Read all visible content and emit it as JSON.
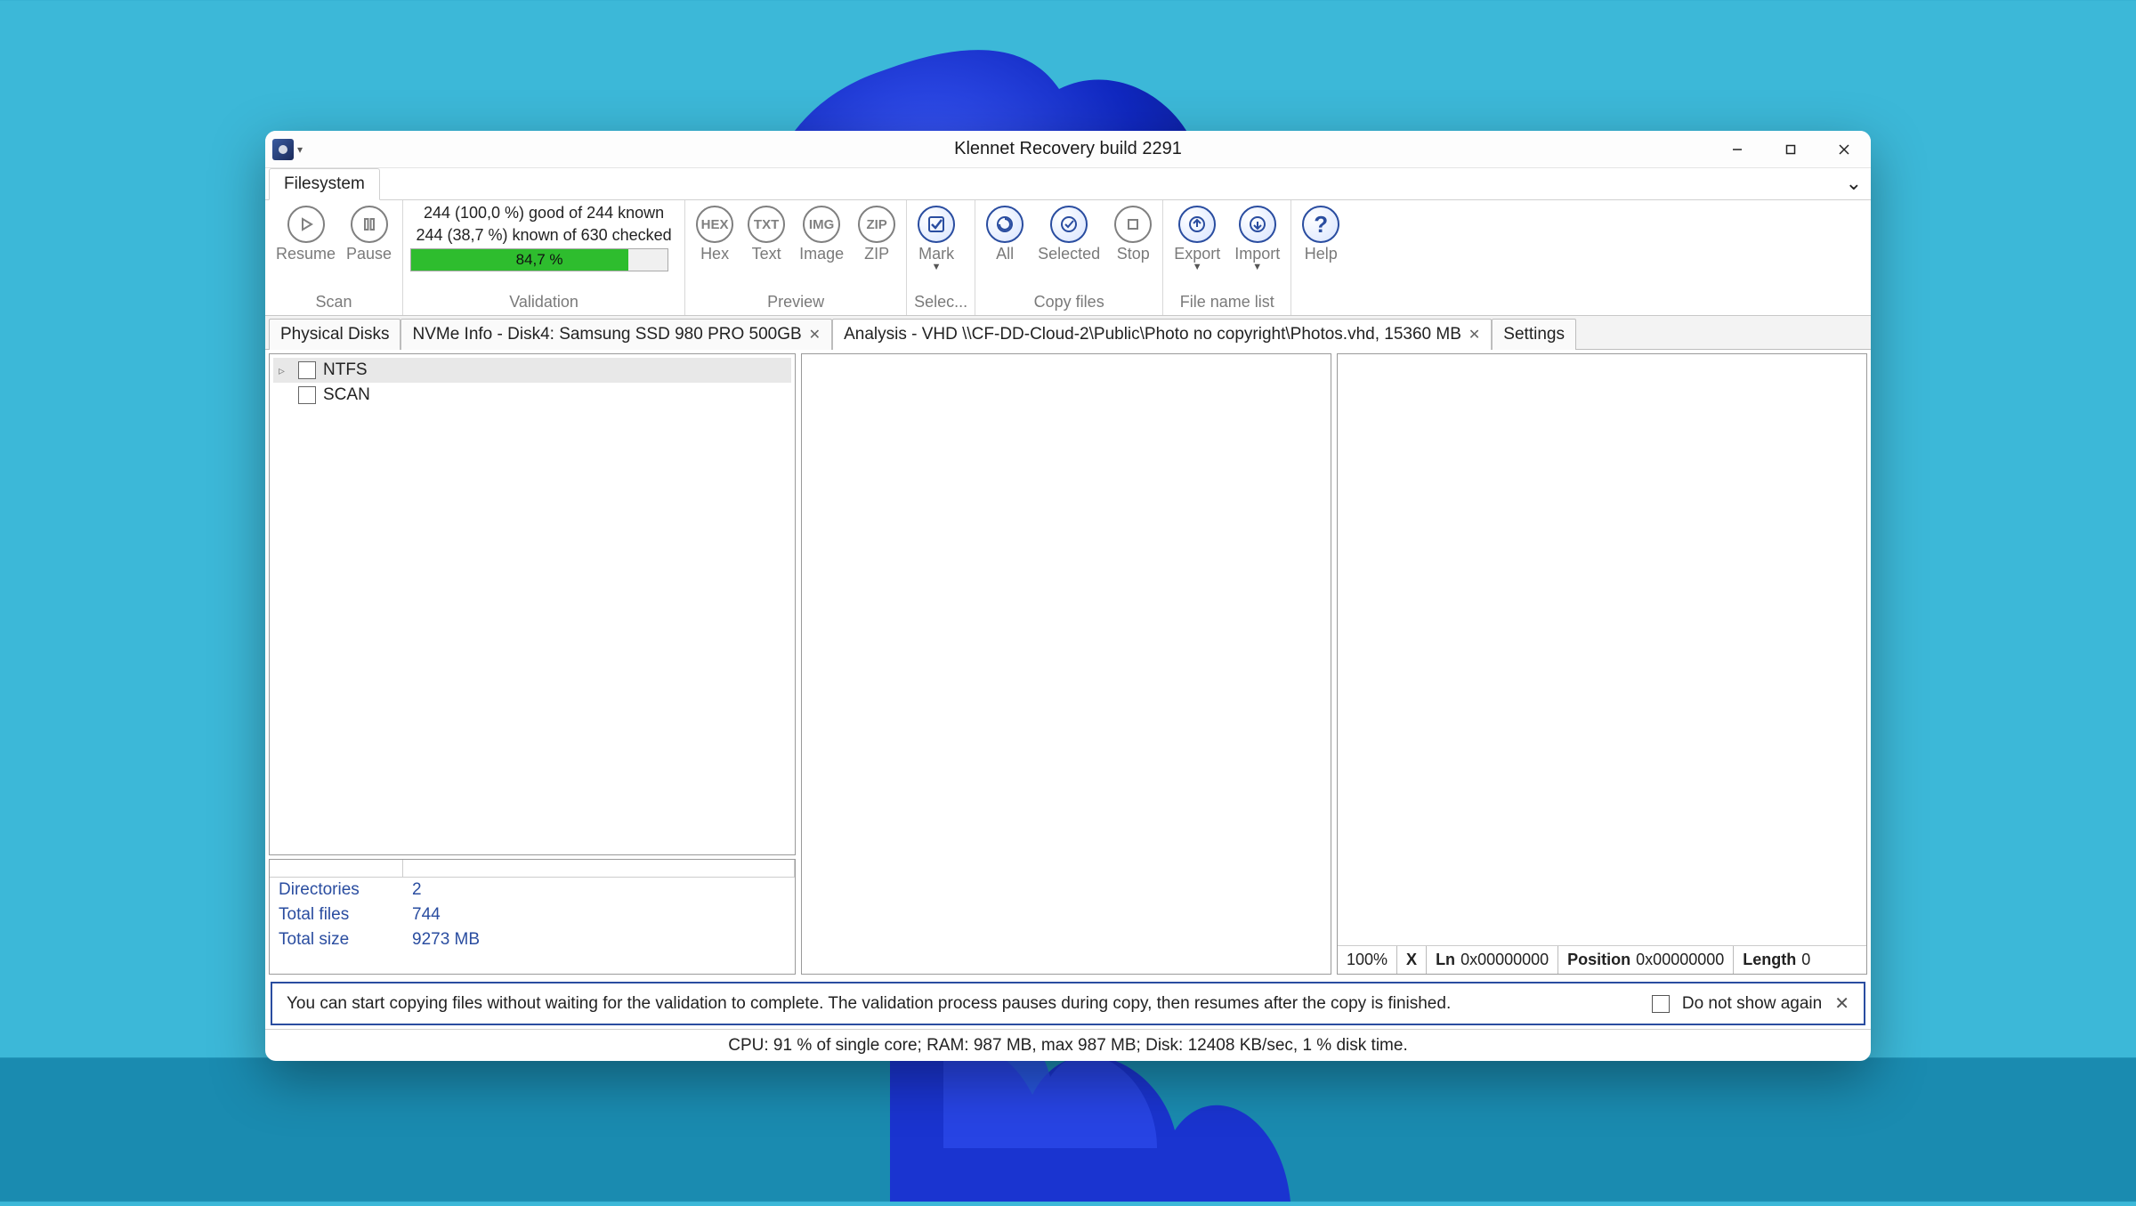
{
  "title": "Klennet Recovery build 2291",
  "ribbon_tab": "Filesystem",
  "scan": {
    "resume": "Resume",
    "pause": "Pause",
    "group": "Scan"
  },
  "validation": {
    "line1": "244 (100,0 %) good of 244 known",
    "line2": "244 (38,7 %) known of 630 checked",
    "percent": "84,7 %",
    "percent_num": 84.7,
    "group": "Validation"
  },
  "preview": {
    "hex": "Hex",
    "txt": "Text",
    "img": "Image",
    "zip": "ZIP",
    "group": "Preview"
  },
  "select": {
    "mark": "Mark",
    "group": "Selec..."
  },
  "copy": {
    "all": "All",
    "selected": "Selected",
    "stop": "Stop",
    "group": "Copy files"
  },
  "fnl": {
    "export": "Export",
    "import": "Import",
    "group": "File name list"
  },
  "help": {
    "help": "Help"
  },
  "doctabs": {
    "t1": "Physical Disks",
    "t2": "NVMe Info - Disk4:  Samsung SSD 980 PRO 500GB",
    "t3": "Analysis - VHD \\\\CF-DD-Cloud-2\\Public\\Photo no copyright\\Photos.vhd, 15360 MB",
    "t4": "Settings"
  },
  "tree": {
    "ntfs": "NTFS",
    "scan": "SCAN"
  },
  "stats": {
    "directories_k": "Directories",
    "directories_v": "2",
    "totalfiles_k": "Total files",
    "totalfiles_v": "744",
    "totalsize_k": "Total size",
    "totalsize_v": "9273 MB"
  },
  "hexbar": {
    "zoom": "100%",
    "x": "X",
    "ln_k": "Ln",
    "ln_v": "0x00000000",
    "pos_k": "Position",
    "pos_v": "0x00000000",
    "len_k": "Length",
    "len_v": "0"
  },
  "info": {
    "msg": "You can start copying files without waiting for the validation to complete. The validation process pauses during copy, then resumes after the copy is finished.",
    "dns": "Do not show again"
  },
  "status": "CPU: 91 % of single core; RAM: 987 MB, max 987 MB; Disk: 12408 KB/sec, 1 % disk time."
}
